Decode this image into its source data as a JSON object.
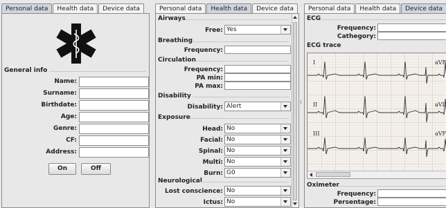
{
  "panel1": {
    "tabs": [
      "Personal data",
      "Health data",
      "Device data"
    ],
    "general_info_title": "General info",
    "fields": [
      {
        "label": "Name:",
        "value": ""
      },
      {
        "label": "Surname:",
        "value": ""
      },
      {
        "label": "Birthdate:",
        "value": ""
      },
      {
        "label": "Age:",
        "value": ""
      },
      {
        "label": "Genre:",
        "value": ""
      },
      {
        "label": "CF:",
        "value": ""
      },
      {
        "label": "Address:",
        "value": ""
      }
    ],
    "on_label": "On",
    "off_label": "Off"
  },
  "panel2": {
    "tabs": [
      "Personal data",
      "Health data",
      "Device data"
    ],
    "airways": {
      "title": "Airways",
      "free_label": "Free:",
      "free_value": "Yes"
    },
    "breathing": {
      "title": "Breathing",
      "frequency_label": "Frequency:"
    },
    "circulation": {
      "title": "Circulation",
      "frequency_label": "Frequency:",
      "pa_min_label": "PA min:",
      "pa_max_label": "PA max:"
    },
    "disability": {
      "title": "Disability",
      "disability_label": "Disability:",
      "disability_value": "Alert"
    },
    "exposure": {
      "title": "Exposure",
      "items": [
        {
          "label": "Head:",
          "value": "No"
        },
        {
          "label": "Facial:",
          "value": "No"
        },
        {
          "label": "Spinal:",
          "value": "No"
        },
        {
          "label": "Multi:",
          "value": "No"
        },
        {
          "label": "Burn:",
          "value": "G0"
        }
      ]
    },
    "neurological": {
      "title": "Neurological",
      "items": [
        {
          "label": "Lost conscience:",
          "value": "No"
        },
        {
          "label": "Ictus:",
          "value": "No"
        }
      ]
    }
  },
  "panel3": {
    "tabs": [
      "Personal data",
      "Health data",
      "Device data"
    ],
    "ecg": {
      "title": "ECG",
      "frequency_label": "Frequency:",
      "category_label": "Cathegory:"
    },
    "ecg_trace_title": "ECG trace",
    "leads_left": [
      "I",
      "II",
      "III"
    ],
    "leads_right": [
      "aVR",
      "aVL",
      "aVF"
    ],
    "oximeter": {
      "title": "Oximeter",
      "frequency_label": "Frequency:",
      "percentage_label": "Persentage:"
    }
  },
  "colors": {
    "active_tab": "#cfd6de",
    "star_of_life": "#111111"
  }
}
